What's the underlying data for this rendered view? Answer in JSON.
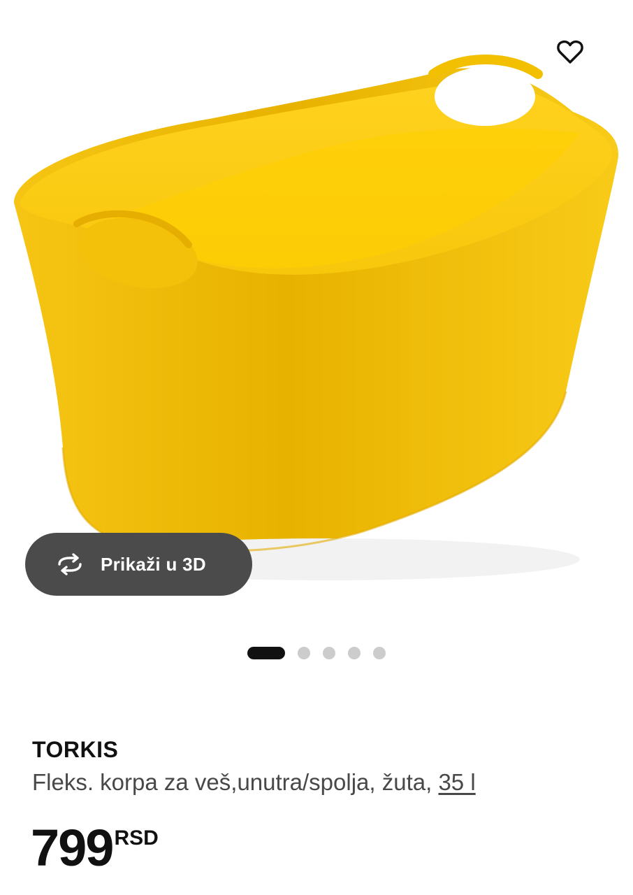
{
  "product": {
    "name": "TORKIS",
    "description": "Fleks. korpa za veš,unutra/spolja, žuta, ",
    "size_link": "35 l",
    "price": "799",
    "currency": "RSD"
  },
  "media": {
    "view_3d_label": "Prikaži u 3D",
    "image_count": 5,
    "active_image_index": 0,
    "product_color": "#F5C400"
  },
  "icons": {
    "favorite": "heart-icon",
    "view_3d": "rotate-3d-icon"
  },
  "colors": {
    "view_3d_button_bg": "#4b4b4b",
    "dot_active": "#111111",
    "dot_inactive": "#cccccc"
  }
}
